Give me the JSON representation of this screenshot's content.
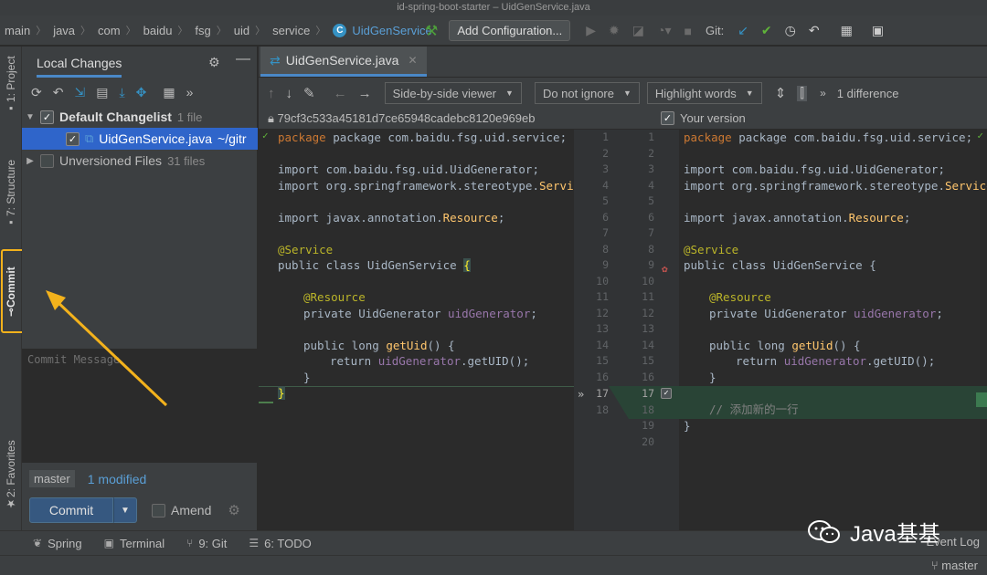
{
  "window": {
    "title": "id-spring-boot-starter – UidGenService.java"
  },
  "breadcrumbs": [
    "main",
    "java",
    "com",
    "baidu",
    "fsg",
    "uid",
    "service"
  ],
  "active_class": "UidGenService",
  "toolbar": {
    "add_configuration": "Add Configuration...",
    "git_label": "Git:"
  },
  "left_stripe": {
    "project": "1: Project",
    "structure": "7: Structure",
    "commit": "Commit",
    "favorites": "2: Favorites"
  },
  "commit_panel": {
    "tab": "Local Changes",
    "default_changelist": "Default Changelist",
    "default_count": "1 file",
    "file_name": "UidGenService.java",
    "file_path": "~/gitr",
    "unversioned": "Unversioned Files",
    "unversioned_count": "31 files",
    "commit_message_placeholder": "Commit Message",
    "branch": "master",
    "modified": "1 modified",
    "commit_button": "Commit",
    "amend": "Amend"
  },
  "editor_tab": "UidGenService.java",
  "diff_toolbar": {
    "viewer": "Side-by-side viewer",
    "ignore": "Do not ignore",
    "highlight": "Highlight words",
    "differences": "1 difference"
  },
  "diff_header": {
    "left_revision": "79cf3c533a45181d7ce65948cadebc8120e969eb",
    "right_label": "Your version"
  },
  "left_line_numbers": [
    "1",
    "2",
    "3",
    "4",
    "5",
    "6",
    "7",
    "8",
    "9",
    "10",
    "11",
    "12",
    "13",
    "14",
    "15",
    "16",
    "17",
    "18"
  ],
  "right_line_numbers": [
    "1",
    "2",
    "3",
    "4",
    "5",
    "6",
    "7",
    "8",
    "9",
    "10",
    "11",
    "12",
    "13",
    "14",
    "15",
    "16",
    "17",
    "18",
    "19",
    "20"
  ],
  "code": {
    "package": "package com.baidu.fsg.uid.service;",
    "import1": "import com.baidu.fsg.uid.UidGenerator;",
    "import2_a": "import org.springframework.stereotype.",
    "import2_b": "Servic",
    "import2_b_right": "Service",
    "import3_a": "import javax.annotation.",
    "import3_b": "Resource",
    "annotation_service": "@Service",
    "class_decl": "public class UidGenService ",
    "brace_open": "{",
    "annotation_resource": "@Resource",
    "field_a": "private UidGenerator ",
    "field_b": "uidGenerator",
    "method_a": "public long ",
    "method_b": "getUid",
    "method_c": "() {",
    "return_a": "return ",
    "return_b": "uidGenerator",
    "return_c": ".getUID();",
    "brace_close_inner": "}",
    "brace_close": "}",
    "added_comment": "// 添加新的一行"
  },
  "bottom_tabs": {
    "spring": "Spring",
    "terminal": "Terminal",
    "git": "9: Git",
    "todo": "6: TODO",
    "event_log": "Event Log"
  },
  "status": {
    "branch": "master"
  },
  "watermark": "Java基基",
  "colors": {
    "accent_blue": "#4a88c7",
    "highlight_frame": "#f3b21c",
    "added_green": "#294436"
  }
}
